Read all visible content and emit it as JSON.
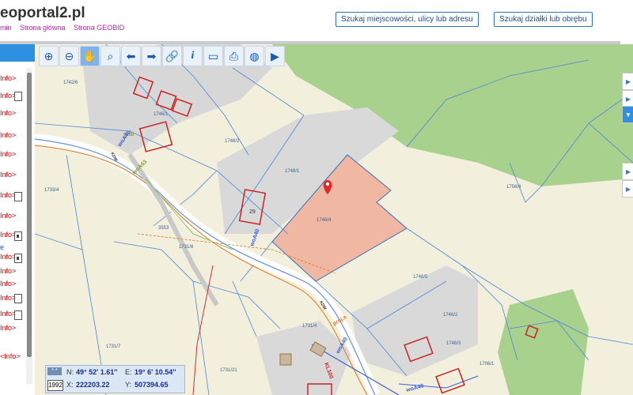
{
  "header": {
    "logo_text": "eoportal2.pl",
    "links": [
      "min",
      "Strona główna",
      "Strona GEOBID"
    ],
    "search_place_button": "Szukaj miejscowości, ulicy lub adresu",
    "search_parcel_button": "Szukaj działki lub obrębu"
  },
  "sidebar": {
    "items": [
      {
        "label": "Info>"
      },
      {
        "label": "Info>"
      },
      {
        "label": "Info>"
      },
      {
        "label": "Info>"
      },
      {
        "label": "Info>"
      },
      {
        "label": "Info>"
      },
      {
        "label": "Info>"
      },
      {
        "label": "Info>"
      },
      {
        "label": "Info>"
      },
      {
        "label": "Info>"
      },
      {
        "label": "e"
      },
      {
        "label": "Info>"
      },
      {
        "label": "Info>"
      },
      {
        "label": "Info>"
      },
      {
        "label": "Info>"
      },
      {
        "label": "Info>"
      },
      {
        "label": "<Info>"
      }
    ]
  },
  "toolbar": {
    "tools": [
      {
        "icon": "zoom-in-icon",
        "glyph": "⊕"
      },
      {
        "icon": "zoom-out-icon",
        "glyph": "⊖"
      },
      {
        "icon": "pan-hand-icon",
        "glyph": "✋"
      },
      {
        "icon": "zoom-window-icon",
        "glyph": "⌕"
      },
      {
        "icon": "back-arrow-icon",
        "glyph": "⬅"
      },
      {
        "icon": "forward-arrow-icon",
        "glyph": "➡"
      },
      {
        "icon": "link-icon",
        "glyph": "🔗"
      },
      {
        "icon": "info-icon",
        "glyph": "i"
      },
      {
        "icon": "measure-ruler-icon",
        "glyph": "▭"
      },
      {
        "icon": "print-icon",
        "glyph": "⎙"
      },
      {
        "icon": "globe-icon",
        "glyph": "◍"
      },
      {
        "icon": "camera-icon",
        "glyph": "▶"
      }
    ]
  },
  "map": {
    "parcel_labels": [
      "1742/6",
      "1746/2",
      "1746/3",
      "1748/2",
      "1748/1",
      "1748/4",
      "1748/5",
      "1756/4",
      "1733/4",
      "1731/7",
      "1731/4",
      "1731/21",
      "1731/8",
      "3553",
      "1706/1",
      "1746/1"
    ],
    "building_labels": [
      "29"
    ],
    "road_labels": [
      "gnB",
      "woA40-",
      "woA63",
      "KDW",
      "woA40",
      "KDW",
      "proj.e",
      "woA40",
      "KL100",
      "woA40"
    ],
    "selected_parcel": "1748/4",
    "marker_icon": "location-pin-icon"
  },
  "coordinates": {
    "epsg_label": "1992",
    "scale_label": "* *",
    "n_label": "N:",
    "n_value": "49° 52' 1.61''",
    "e_label": "E:",
    "e_value": "19° 6' 10.54''",
    "x_label": "X:",
    "x_value": "222203.22",
    "y_label": "Y:",
    "y_value": "507394.65"
  },
  "colors": {
    "accent": "#2f8fe0",
    "selected_parcel_fill": "#f0b7a2",
    "forest": "#a9d18e",
    "building": "#cc3333"
  }
}
